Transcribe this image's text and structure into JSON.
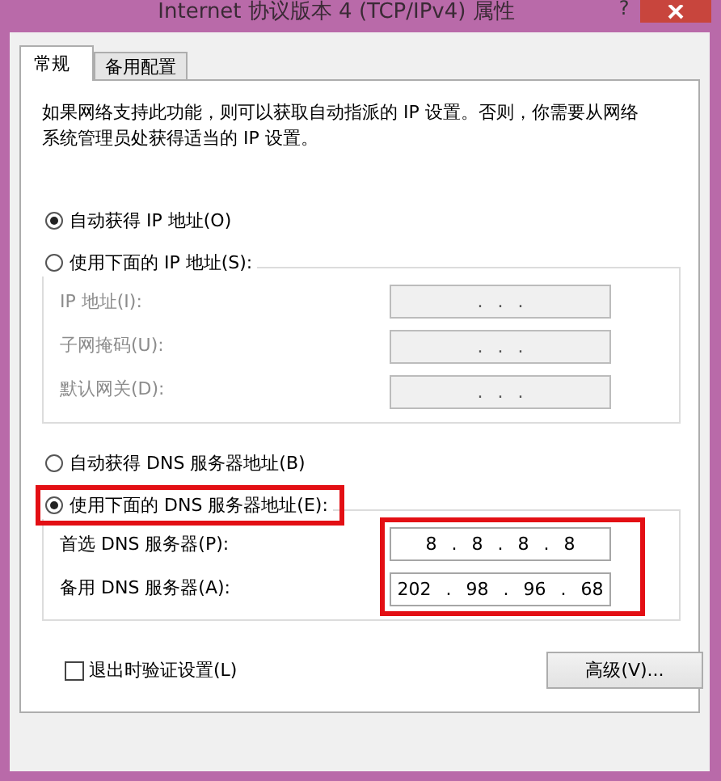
{
  "window": {
    "title": "Internet 协议版本 4 (TCP/IPv4) 属性",
    "help": "?"
  },
  "tabs": [
    {
      "label": "常规",
      "selected": true
    },
    {
      "label": "备用配置",
      "selected": false
    }
  ],
  "description": "如果网络支持此功能，则可以获取自动指派的 IP 设置。否则，你需要从网络系统管理员处获得适当的 IP 设置。",
  "ip_section": {
    "options": [
      {
        "label": "自动获得 IP 地址(O)",
        "selected": true,
        "highlighted": false
      },
      {
        "label": "使用下面的 IP 地址(S):",
        "selected": false,
        "highlighted": false
      }
    ],
    "highlighted": false,
    "fields": [
      {
        "label": "IP 地址(I):",
        "value": ". . .",
        "disabled": true
      },
      {
        "label": "子网掩码(U):",
        "value": ". . .",
        "disabled": true
      },
      {
        "label": "默认网关(D):",
        "value": ". . .",
        "disabled": true
      }
    ]
  },
  "dns_section": {
    "options": [
      {
        "label": "自动获得 DNS 服务器地址(B)",
        "selected": false,
        "highlighted": false
      },
      {
        "label": "使用下面的 DNS 服务器地址(E):",
        "selected": true,
        "highlighted": true
      }
    ],
    "highlighted": true,
    "fields": [
      {
        "label": "首选 DNS 服务器(P):",
        "value": "8 . 8 . 8 . 8",
        "disabled": false
      },
      {
        "label": "备用 DNS 服务器(A):",
        "value": "202 . 98 . 96 . 68",
        "disabled": false
      }
    ]
  },
  "validate_checkbox": {
    "label": "退出时验证设置(L)",
    "checked": false
  },
  "advanced_button": "高级(V)..."
}
